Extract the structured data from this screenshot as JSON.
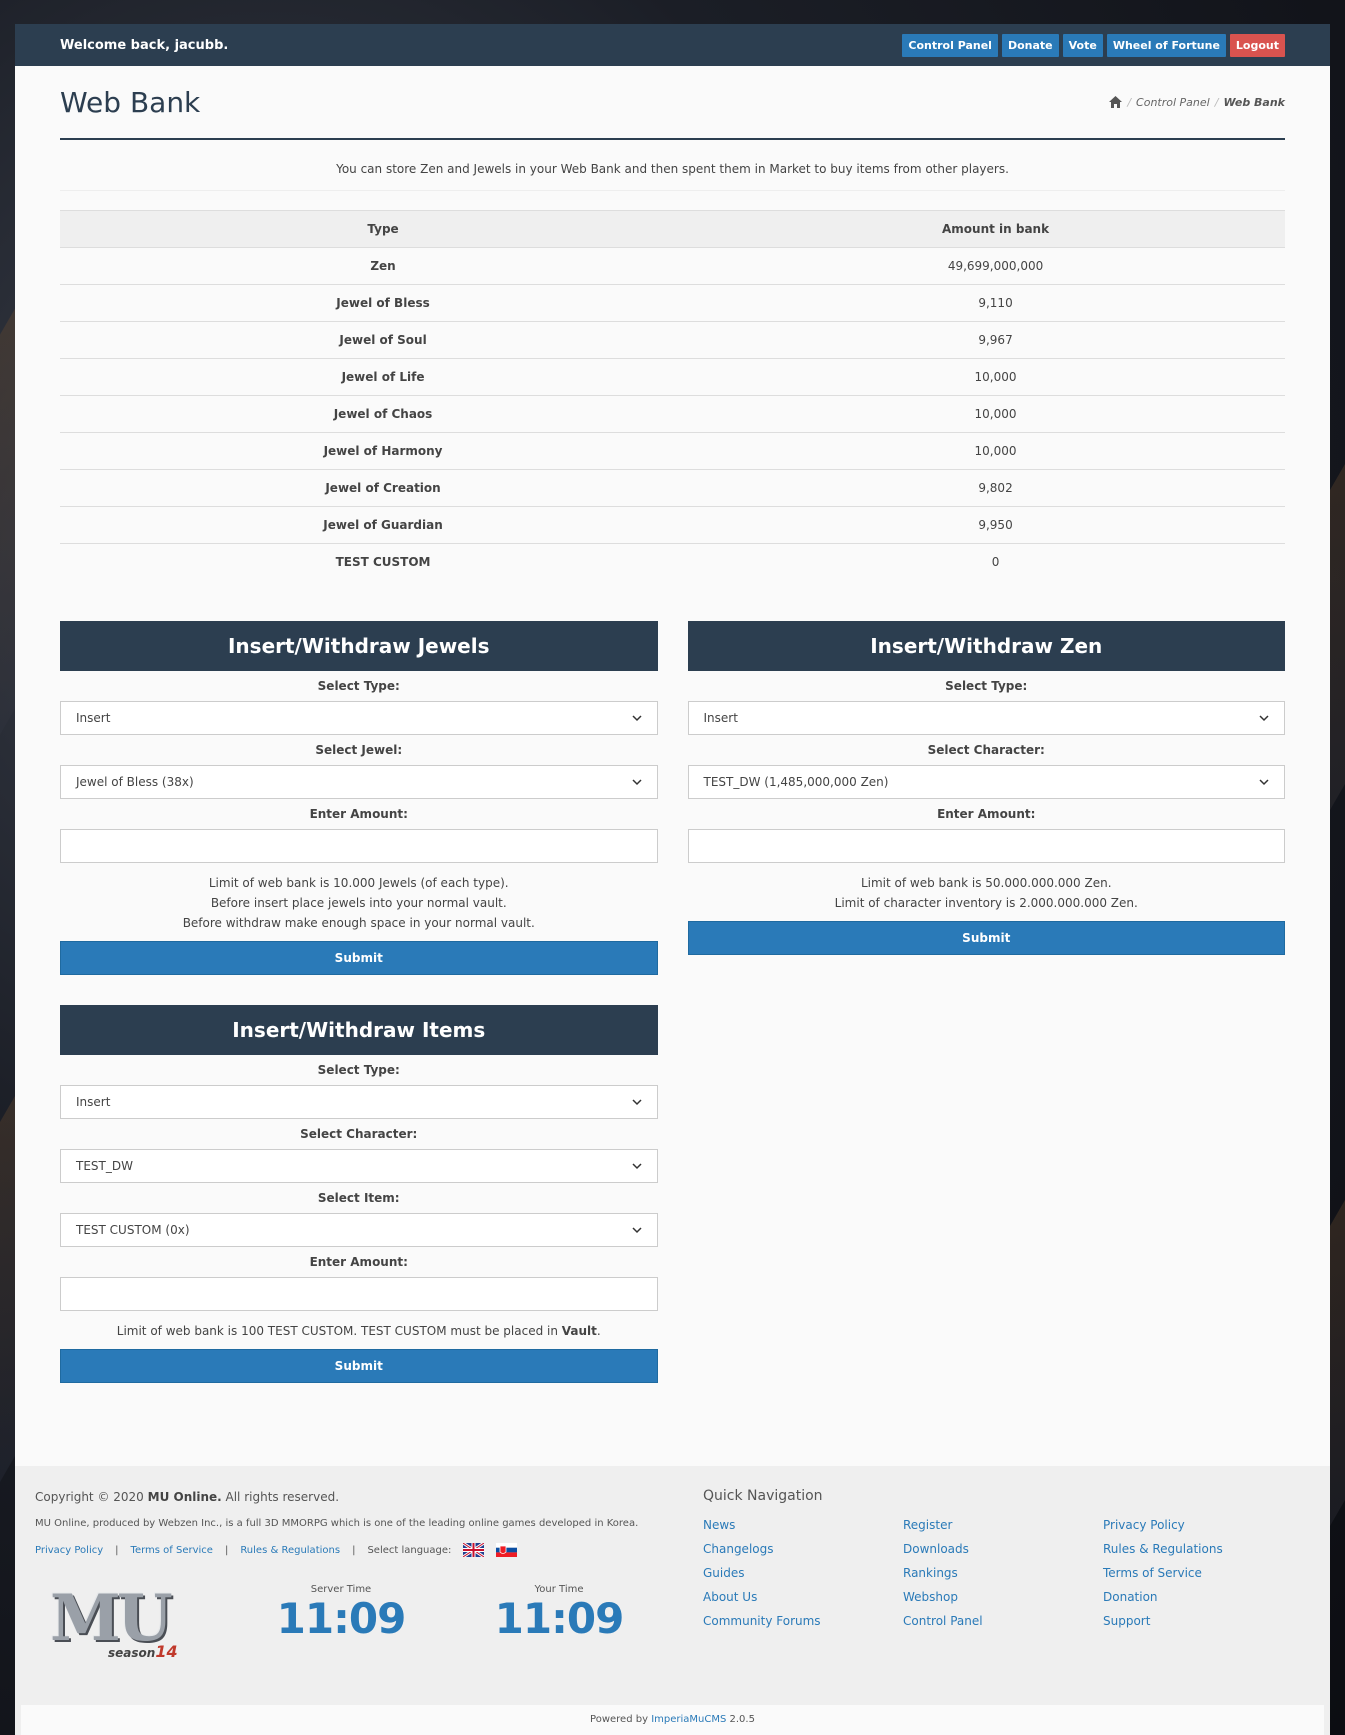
{
  "topbar": {
    "welcome": "Welcome back, jacubb.",
    "nav": [
      "Control Panel",
      "Donate",
      "Vote",
      "Wheel of Fortune",
      "Logout"
    ]
  },
  "header": {
    "title": "Web Bank",
    "breadcrumb": [
      "Control Panel",
      "Web Bank"
    ]
  },
  "intro": "You can store Zen and Jewels in your Web Bank and then spent them in Market to buy items from other players.",
  "bank_table": {
    "headers": [
      "Type",
      "Amount in bank"
    ],
    "rows": [
      [
        "Zen",
        "49,699,000,000"
      ],
      [
        "Jewel of Bless",
        "9,110"
      ],
      [
        "Jewel of Soul",
        "9,967"
      ],
      [
        "Jewel of Life",
        "10,000"
      ],
      [
        "Jewel of Chaos",
        "10,000"
      ],
      [
        "Jewel of Harmony",
        "10,000"
      ],
      [
        "Jewel of Creation",
        "9,802"
      ],
      [
        "Jewel of Guardian",
        "9,950"
      ],
      [
        "TEST CUSTOM",
        "0"
      ]
    ]
  },
  "jewels_panel": {
    "title": "Insert/Withdraw Jewels",
    "type_label": "Select Type:",
    "type_value": "Insert",
    "jewel_label": "Select Jewel:",
    "jewel_value": "Jewel of Bless (38x)",
    "amount_label": "Enter Amount:",
    "amount_value": "",
    "notes": [
      "Limit of web bank is 10.000 Jewels (of each type).",
      "Before insert place jewels into your normal vault.",
      "Before withdraw make enough space in your normal vault."
    ],
    "submit": "Submit"
  },
  "zen_panel": {
    "title": "Insert/Withdraw Zen",
    "type_label": "Select Type:",
    "type_value": "Insert",
    "char_label": "Select Character:",
    "char_value": "TEST_DW (1,485,000,000 Zen)",
    "amount_label": "Enter Amount:",
    "amount_value": "",
    "notes": [
      "Limit of web bank is 50.000.000.000 Zen.",
      "Limit of character inventory is 2.000.000.000 Zen."
    ],
    "submit": "Submit"
  },
  "items_panel": {
    "title": "Insert/Withdraw Items",
    "type_label": "Select Type:",
    "type_value": "Insert",
    "char_label": "Select Character:",
    "char_value": "TEST_DW",
    "item_label": "Select Item:",
    "item_value": "TEST CUSTOM (0x)",
    "amount_label": "Enter Amount:",
    "amount_value": "",
    "note_prefix": "Limit of web bank is 100 TEST CUSTOM. TEST CUSTOM must be placed in ",
    "note_bold": "Vault",
    "note_suffix": ".",
    "submit": "Submit"
  },
  "footer": {
    "copyright_prefix": "Copyright © 2020 ",
    "copyright_brand": "MU Online.",
    "copyright_suffix": " All rights reserved.",
    "description": "MU Online, produced by Webzen Inc., is a full 3D MMORPG which is one of the leading online games developed in Korea.",
    "links": [
      "Privacy Policy",
      "Terms of Service",
      "Rules & Regulations"
    ],
    "separator": "|",
    "language_label": "Select language:",
    "logo_text": "MU",
    "logo_season": "season",
    "logo_season_num": "14",
    "server_time_label": "Server Time",
    "server_time": "11:09",
    "your_time_label": "Your Time",
    "your_time": "11:09",
    "quick_nav_title": "Quick Navigation",
    "quick_nav": [
      [
        "News",
        "Changelogs",
        "Guides",
        "About Us",
        "Community Forums"
      ],
      [
        "Register",
        "Downloads",
        "Rankings",
        "Webshop",
        "Control Panel"
      ],
      [
        "Privacy Policy",
        "Rules & Regulations",
        "Terms of Service",
        "Donation",
        "Support"
      ]
    ],
    "powered_prefix": "Powered by ",
    "powered_link": "ImperiaMuCMS",
    "powered_version": " 2.0.5"
  },
  "colors": {
    "dark_navy": "#2c3e50",
    "accent_blue": "#2a7ab8",
    "logout_red": "#d9534f"
  }
}
